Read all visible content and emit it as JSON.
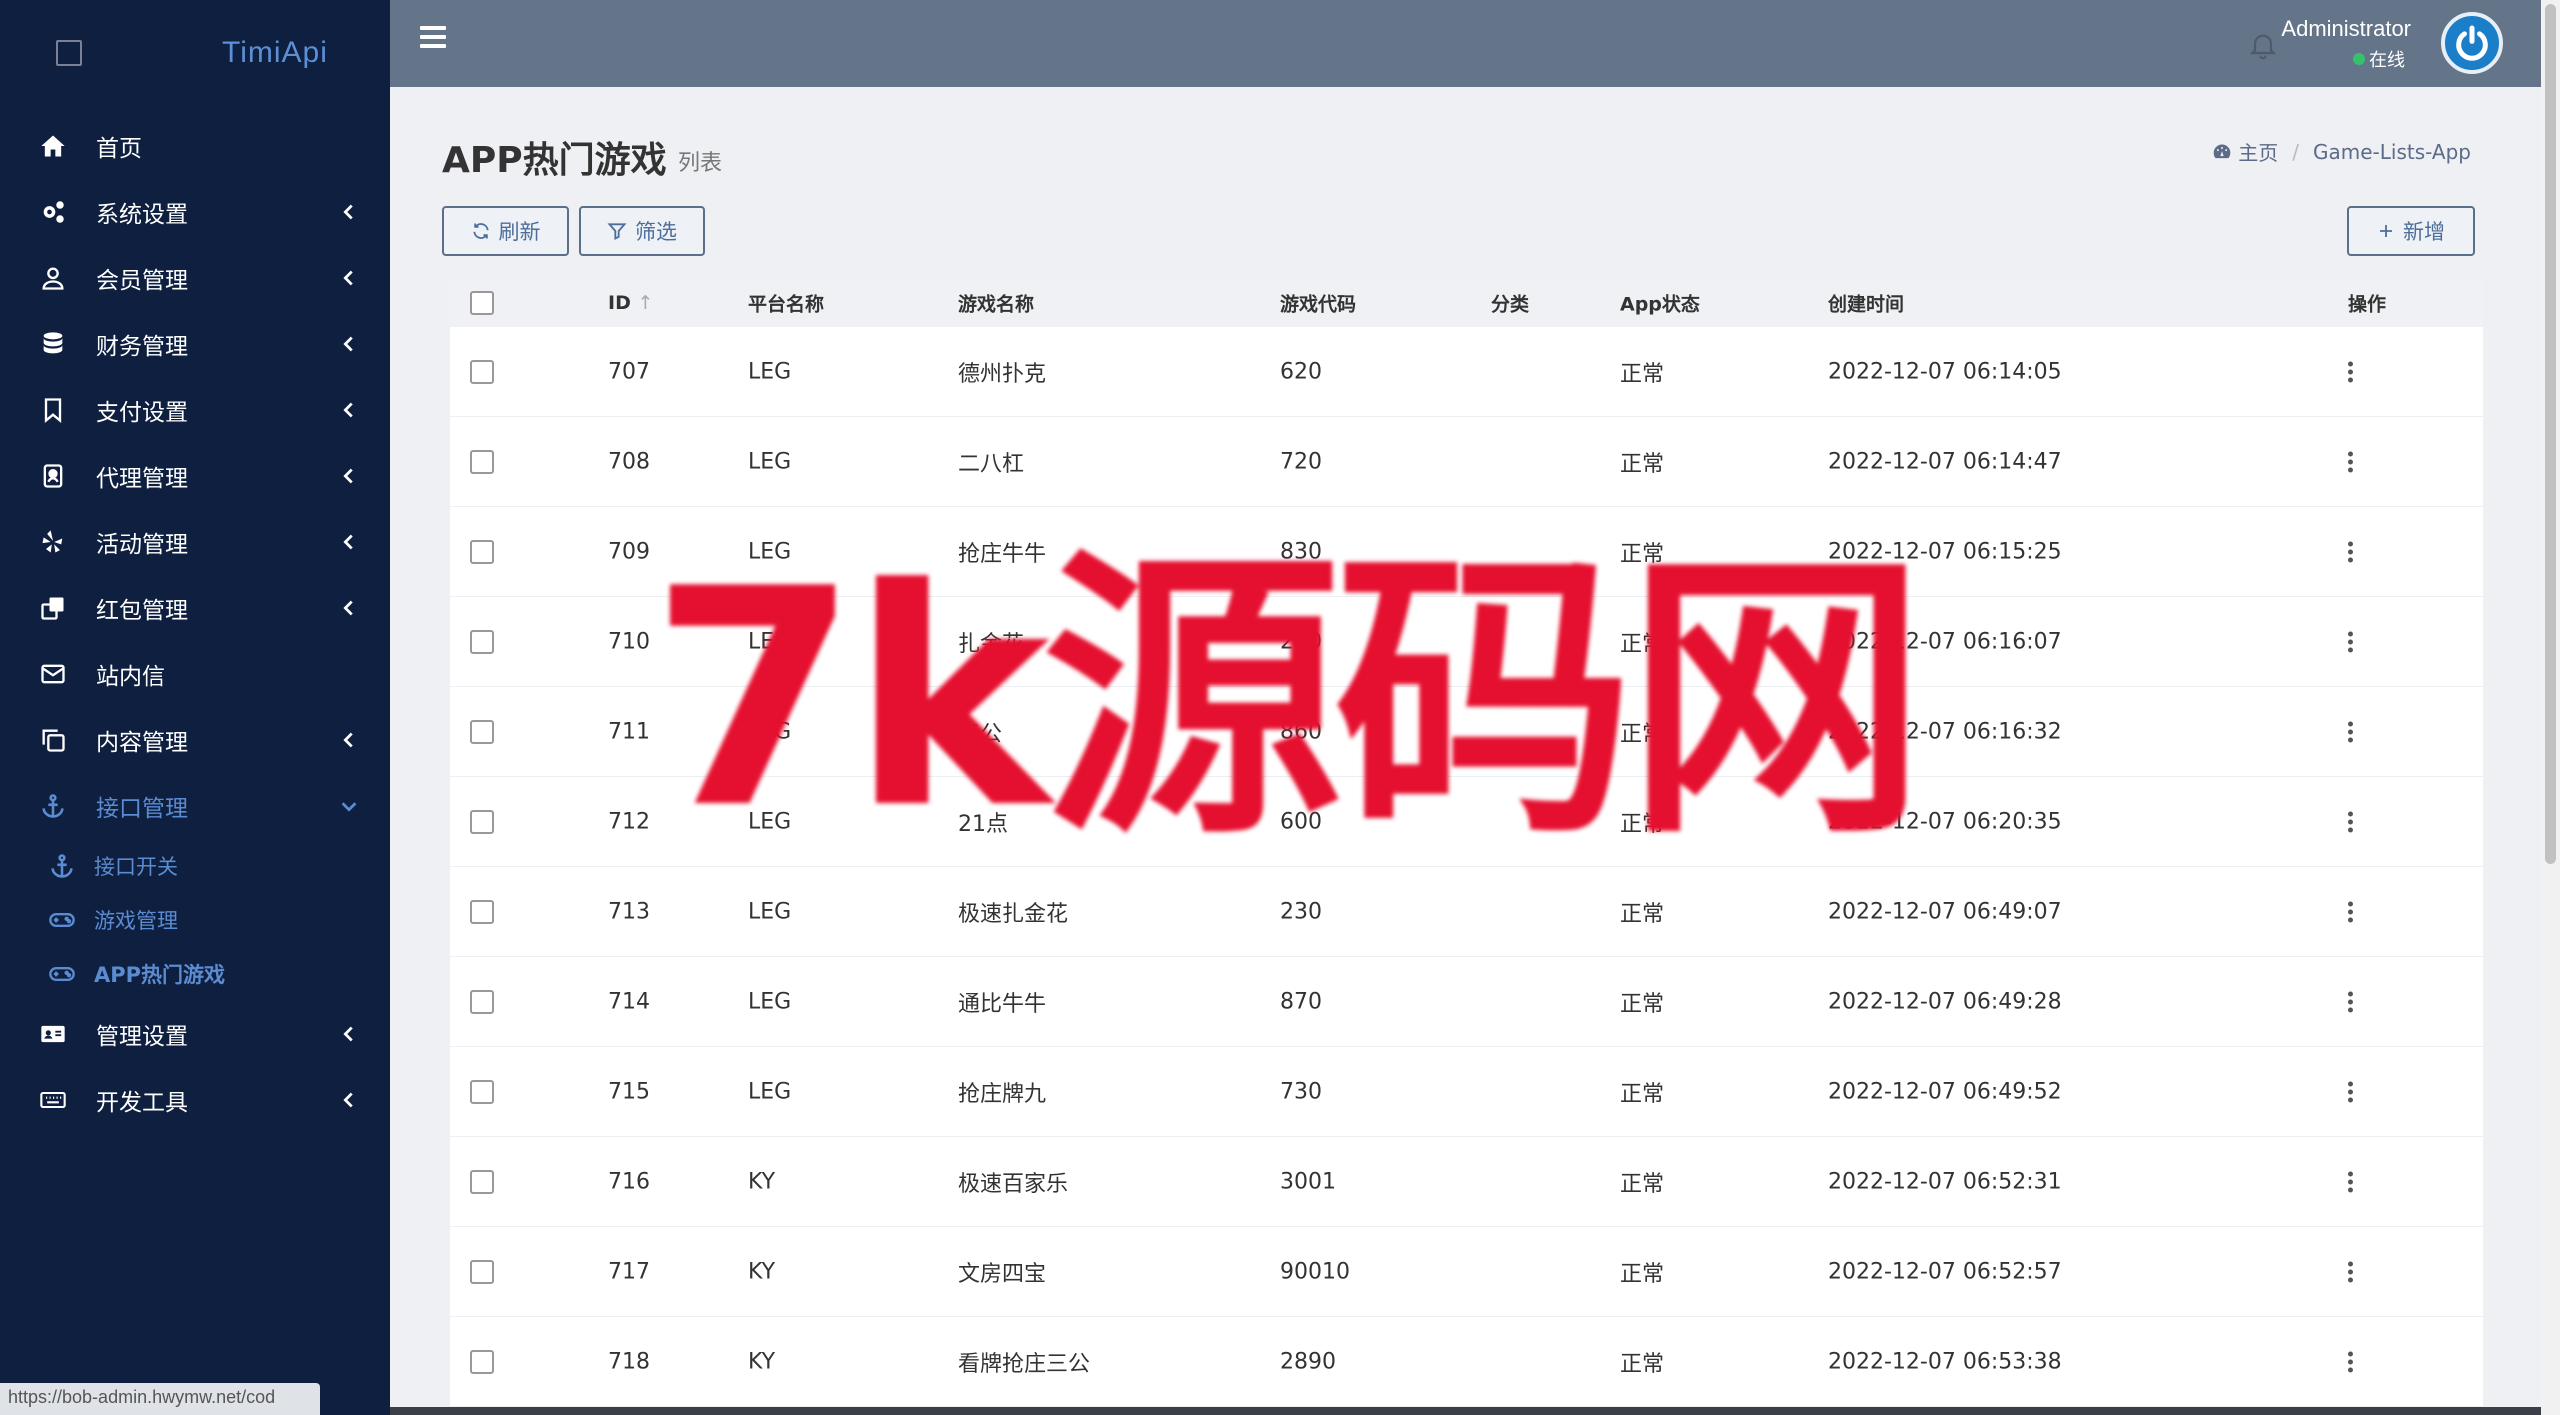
{
  "app": {
    "brand": "TimiApi"
  },
  "sidebar": {
    "items": [
      {
        "label": "首页",
        "icon": "home-icon",
        "has_children": false
      },
      {
        "label": "系统设置",
        "icon": "cogs-icon",
        "has_children": true
      },
      {
        "label": "会员管理",
        "icon": "user-icon",
        "has_children": true
      },
      {
        "label": "财务管理",
        "icon": "database-icon",
        "has_children": true
      },
      {
        "label": "支付设置",
        "icon": "bookmark-icon",
        "has_children": true
      },
      {
        "label": "代理管理",
        "icon": "agent-icon",
        "has_children": true
      },
      {
        "label": "活动管理",
        "icon": "yelp-icon",
        "has_children": true
      },
      {
        "label": "红包管理",
        "icon": "clone-icon",
        "has_children": true
      },
      {
        "label": "站内信",
        "icon": "envelope-icon",
        "has_children": false
      },
      {
        "label": "内容管理",
        "icon": "copy-icon",
        "has_children": true
      },
      {
        "label": "接口管理",
        "icon": "anchor-icon",
        "has_children": true,
        "expanded": true
      },
      {
        "label": "管理设置",
        "icon": "id-card-icon",
        "has_children": true
      },
      {
        "label": "开发工具",
        "icon": "keyboard-icon",
        "has_children": true
      }
    ],
    "submenu": [
      {
        "label": "接口开关",
        "icon": "anchor-icon"
      },
      {
        "label": "游戏管理",
        "icon": "gamepad-icon"
      },
      {
        "label": "APP热门游戏",
        "icon": "gamepad-icon",
        "current": true
      }
    ],
    "status_url": "https://bob-admin.hwymw.net/cod"
  },
  "header": {
    "user_name": "Administrator",
    "user_status": "在线"
  },
  "page": {
    "title": "APP热门游戏",
    "subtitle": "列表",
    "breadcrumb_home": "主页",
    "breadcrumb_current": "Game-Lists-App"
  },
  "toolbar": {
    "refresh_label": "刷新",
    "filter_label": "筛选",
    "add_label": "新增"
  },
  "table": {
    "headers": {
      "id": "ID",
      "platform": "平台名称",
      "name": "游戏名称",
      "code": "游戏代码",
      "category": "分类",
      "app_status": "App状态",
      "created": "创建时间",
      "actions": "操作"
    },
    "rows": [
      {
        "id": "707",
        "platform": "LEG",
        "name": "德州扑克",
        "code": "620",
        "category": "",
        "state": "正常",
        "created": "2022-12-07 06:14:05"
      },
      {
        "id": "708",
        "platform": "LEG",
        "name": "二八杠",
        "code": "720",
        "category": "",
        "state": "正常",
        "created": "2022-12-07 06:14:47"
      },
      {
        "id": "709",
        "platform": "LEG",
        "name": "抢庄牛牛",
        "code": "830",
        "category": "",
        "state": "正常",
        "created": "2022-12-07 06:15:25"
      },
      {
        "id": "710",
        "platform": "LEG",
        "name": "扎金花",
        "code": "220",
        "category": "",
        "state": "正常",
        "created": "2022-12-07 06:16:07"
      },
      {
        "id": "711",
        "platform": "LEG",
        "name": "三公",
        "code": "860",
        "category": "",
        "state": "正常",
        "created": "2022-12-07 06:16:32"
      },
      {
        "id": "712",
        "platform": "LEG",
        "name": "21点",
        "code": "600",
        "category": "",
        "state": "正常",
        "created": "2022-12-07 06:20:35"
      },
      {
        "id": "713",
        "platform": "LEG",
        "name": "极速扎金花",
        "code": "230",
        "category": "",
        "state": "正常",
        "created": "2022-12-07 06:49:07"
      },
      {
        "id": "714",
        "platform": "LEG",
        "name": "通比牛牛",
        "code": "870",
        "category": "",
        "state": "正常",
        "created": "2022-12-07 06:49:28"
      },
      {
        "id": "715",
        "platform": "LEG",
        "name": "抢庄牌九",
        "code": "730",
        "category": "",
        "state": "正常",
        "created": "2022-12-07 06:49:52"
      },
      {
        "id": "716",
        "platform": "KY",
        "name": "极速百家乐",
        "code": "3001",
        "category": "",
        "state": "正常",
        "created": "2022-12-07 06:52:31"
      },
      {
        "id": "717",
        "platform": "KY",
        "name": "文房四宝",
        "code": "90010",
        "category": "",
        "state": "正常",
        "created": "2022-12-07 06:52:57"
      },
      {
        "id": "718",
        "platform": "KY",
        "name": "看牌抢庄三公",
        "code": "2890",
        "category": "",
        "state": "正常",
        "created": "2022-12-07 06:53:38"
      }
    ]
  },
  "watermark": "7k源码网"
}
